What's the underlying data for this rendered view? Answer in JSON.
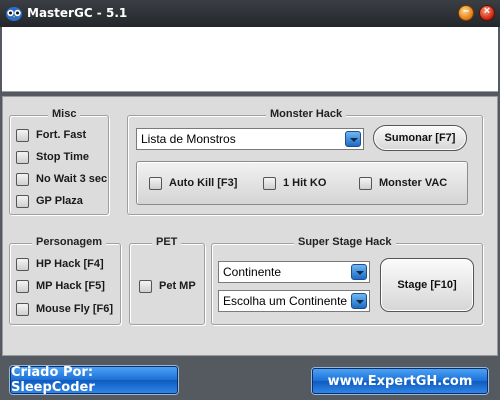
{
  "window": {
    "title": "MasterGC - 5.1",
    "icon": "owl-icon",
    "controls": {
      "minimize_icon": "minimize-icon",
      "close_icon": "close-icon"
    }
  },
  "misc": {
    "title": "Misc",
    "items": [
      {
        "label": "Fort. Fast"
      },
      {
        "label": "Stop Time"
      },
      {
        "label": "No Wait 3 sec"
      },
      {
        "label": "GP Plaza"
      }
    ]
  },
  "monster_hack": {
    "title": "Monster Hack",
    "select_value": "Lista de Monstros",
    "summon_label": "Sumonar [F7]",
    "options": [
      {
        "label": "Auto Kill [F3]"
      },
      {
        "label": "1 Hit KO"
      },
      {
        "label": "Monster VAC"
      }
    ]
  },
  "personagem": {
    "title": "Personagem",
    "items": [
      {
        "label": "HP Hack [F4]"
      },
      {
        "label": "MP Hack [F5]"
      },
      {
        "label": "Mouse Fly [F6]"
      }
    ]
  },
  "pet": {
    "title": "PET",
    "items": [
      {
        "label": "Pet MP"
      }
    ]
  },
  "super_stage": {
    "title": "Super Stage Hack",
    "continent_value": "Continente",
    "choose_value": "Escolha um Continente",
    "stage_label": "Stage [F10]"
  },
  "footer": {
    "credit": "Criado Por: SleepCoder",
    "site": "www.ExpertGH.com"
  },
  "colors": {
    "titlebar": "#2c3035",
    "panel": "#dcdcdc",
    "footer_button": "#1d6fd6",
    "combo_arrow": "#1e6cc4"
  }
}
